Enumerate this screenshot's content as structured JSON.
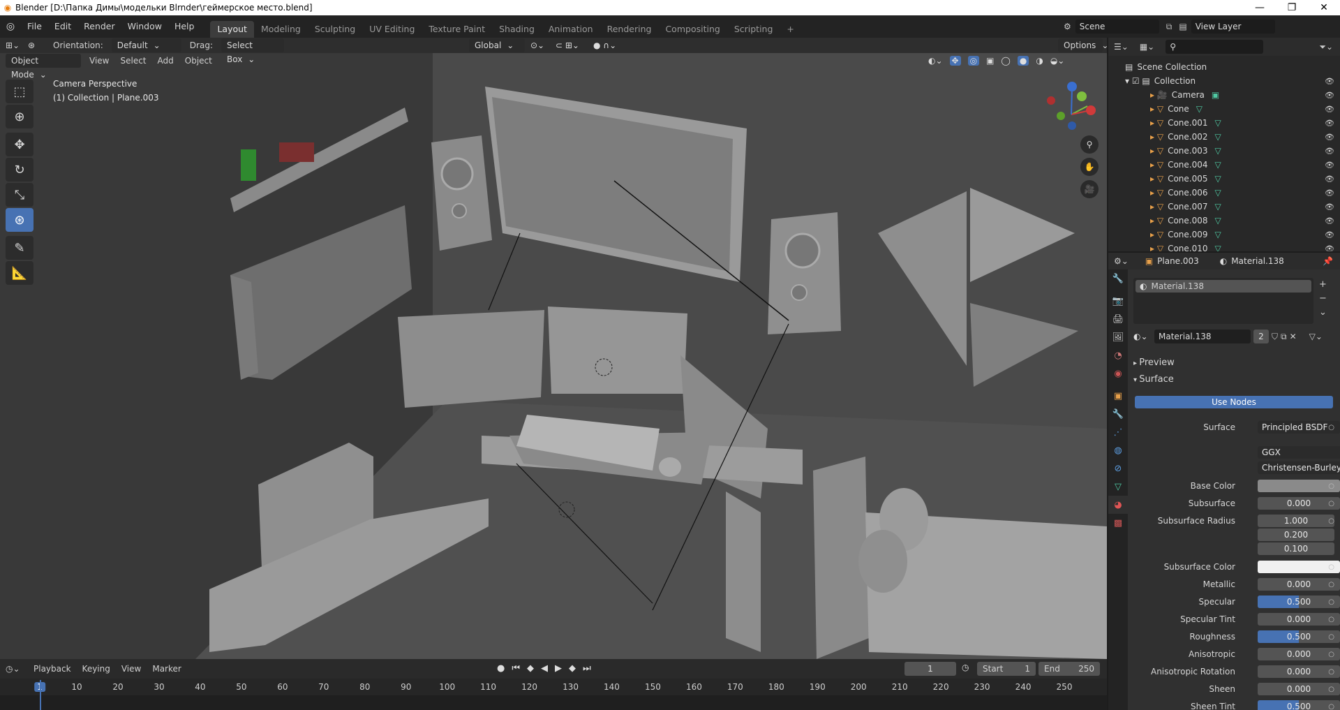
{
  "window": {
    "title": "Blender [D:\\Папка Димы\\модельки Blrnder\\геймерское место.blend]",
    "controls": [
      "—",
      "❐",
      "✕"
    ]
  },
  "menu": [
    "File",
    "Edit",
    "Render",
    "Window",
    "Help"
  ],
  "workspaces": [
    "Layout",
    "Modeling",
    "Sculpting",
    "UV Editing",
    "Texture Paint",
    "Shading",
    "Animation",
    "Rendering",
    "Compositing",
    "Scripting",
    "+"
  ],
  "active_workspace": "Layout",
  "scene": {
    "label": "Scene",
    "view_layer": "View Layer"
  },
  "tool_header": {
    "orientation_label": "Orientation:",
    "orientation_value": "Default",
    "drag_label": "Drag:",
    "drag_value": "Select Box",
    "transform_orientation": "Global",
    "options": "Options"
  },
  "viewport_header": {
    "mode": "Object Mode",
    "menus": [
      "View",
      "Select",
      "Add",
      "Object"
    ]
  },
  "viewport": {
    "overlay_line1": "Camera Perspective",
    "overlay_line2": "(1) Collection | Plane.003"
  },
  "timeline": {
    "menus": [
      "Playback",
      "Keying",
      "View",
      "Marker"
    ],
    "current_frame": "1",
    "start_label": "Start",
    "start": "1",
    "end_label": "End",
    "end": "250",
    "ticks": [
      "1",
      "10",
      "20",
      "30",
      "40",
      "50",
      "60",
      "70",
      "80",
      "90",
      "100",
      "110",
      "120",
      "130",
      "140",
      "150",
      "160",
      "170",
      "180",
      "190",
      "200",
      "210",
      "220",
      "230",
      "240",
      "250"
    ]
  },
  "outliner": {
    "root": "Scene Collection",
    "collection": "Collection",
    "items": [
      "Camera",
      "Cone",
      "Cone.001",
      "Cone.002",
      "Cone.003",
      "Cone.004",
      "Cone.005",
      "Cone.006",
      "Cone.007",
      "Cone.008",
      "Cone.009",
      "Cone.010"
    ]
  },
  "properties": {
    "object": "Plane.003",
    "material": "Material.138",
    "slot": "Material.138",
    "material_field": "Material.138",
    "users": "2",
    "preview": "Preview",
    "surface_section": "Surface",
    "use_nodes": "Use Nodes",
    "surface_label": "Surface",
    "surface_value": "Principled BSDF",
    "distribution": "GGX",
    "subsurface_method": "Christensen-Burley",
    "rows": [
      {
        "label": "Base Color",
        "type": "color",
        "color": "#8a8a8a"
      },
      {
        "label": "Subsurface",
        "value": "0.000",
        "fill": 0
      },
      {
        "label": "Subsurface Radius",
        "value": "1.000",
        "fill": 0
      },
      {
        "label": "",
        "value": "0.200",
        "fill": 0
      },
      {
        "label": "",
        "value": "0.100",
        "fill": 0
      },
      {
        "label": "Subsurface Color",
        "type": "color",
        "color": "#f0f0f0"
      },
      {
        "label": "Metallic",
        "value": "0.000",
        "fill": 0
      },
      {
        "label": "Specular",
        "value": "0.500",
        "fill": 0.5
      },
      {
        "label": "Specular Tint",
        "value": "0.000",
        "fill": 0
      },
      {
        "label": "Roughness",
        "value": "0.500",
        "fill": 0.5
      },
      {
        "label": "Anisotropic",
        "value": "0.000",
        "fill": 0
      },
      {
        "label": "Anisotropic Rotation",
        "value": "0.000",
        "fill": 0
      },
      {
        "label": "Sheen",
        "value": "0.000",
        "fill": 0
      },
      {
        "label": "Sheen Tint",
        "value": "0.500",
        "fill": 0.5
      }
    ]
  },
  "colors": {
    "accent": "#4772b3",
    "viewport_bg": "#3b3b3b",
    "mesh_icon": "#e8a04a",
    "vertex_icon": "#4fc9a3"
  }
}
